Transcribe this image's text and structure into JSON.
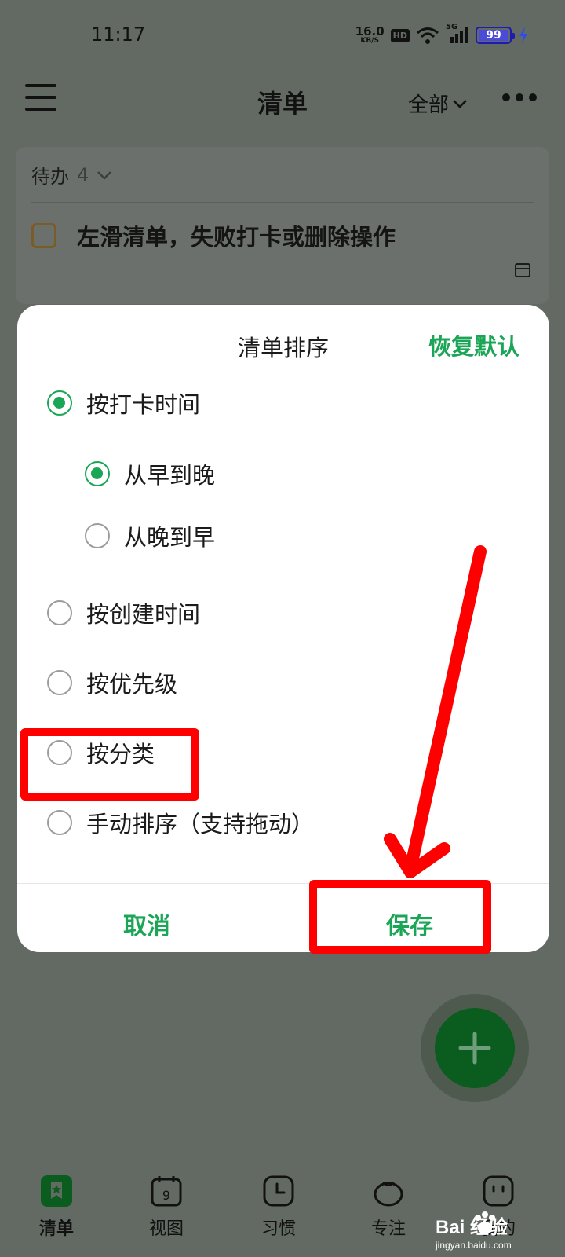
{
  "status_bar": {
    "time": "11:17",
    "net_speed": "16.0",
    "net_unit": "KB/S",
    "hd_label": "HD",
    "signal_label": "5G",
    "battery": "99",
    "battery_level": 0.99
  },
  "header": {
    "title": "清单",
    "filter_label": "全部"
  },
  "list": {
    "section_title": "待办",
    "section_count": "4",
    "task_text": "左滑清单，失败打卡或删除操作"
  },
  "modal": {
    "title": "清单排序",
    "reset_label": "恢复默认",
    "options": [
      {
        "label": "按打卡时间",
        "checked": true
      },
      {
        "label": "从早到晚",
        "checked": true
      },
      {
        "label": "从晚到早",
        "checked": false
      },
      {
        "label": "按创建时间",
        "checked": false
      },
      {
        "label": "按优先级",
        "checked": false
      },
      {
        "label": "按分类",
        "checked": false
      },
      {
        "label": "手动排序（支持拖动）",
        "checked": false
      }
    ],
    "cancel_label": "取消",
    "save_label": "保存"
  },
  "bottom_nav": {
    "items": [
      {
        "label": "清单",
        "icon": "checklist-icon",
        "active": true
      },
      {
        "label": "视图",
        "icon": "calendar-icon",
        "day": "9"
      },
      {
        "label": "习惯",
        "icon": "clock-icon"
      },
      {
        "label": "专注",
        "icon": "tomato-icon"
      },
      {
        "label": "我的",
        "icon": "profile-icon"
      }
    ]
  },
  "watermark": {
    "text": "Bai 经验",
    "sub": "jingyan.baidu.com"
  },
  "colors": {
    "accent": "#1aa656",
    "annotation": "#ff0000",
    "fab": "#0a5c1f",
    "overlay": "#636a63"
  }
}
